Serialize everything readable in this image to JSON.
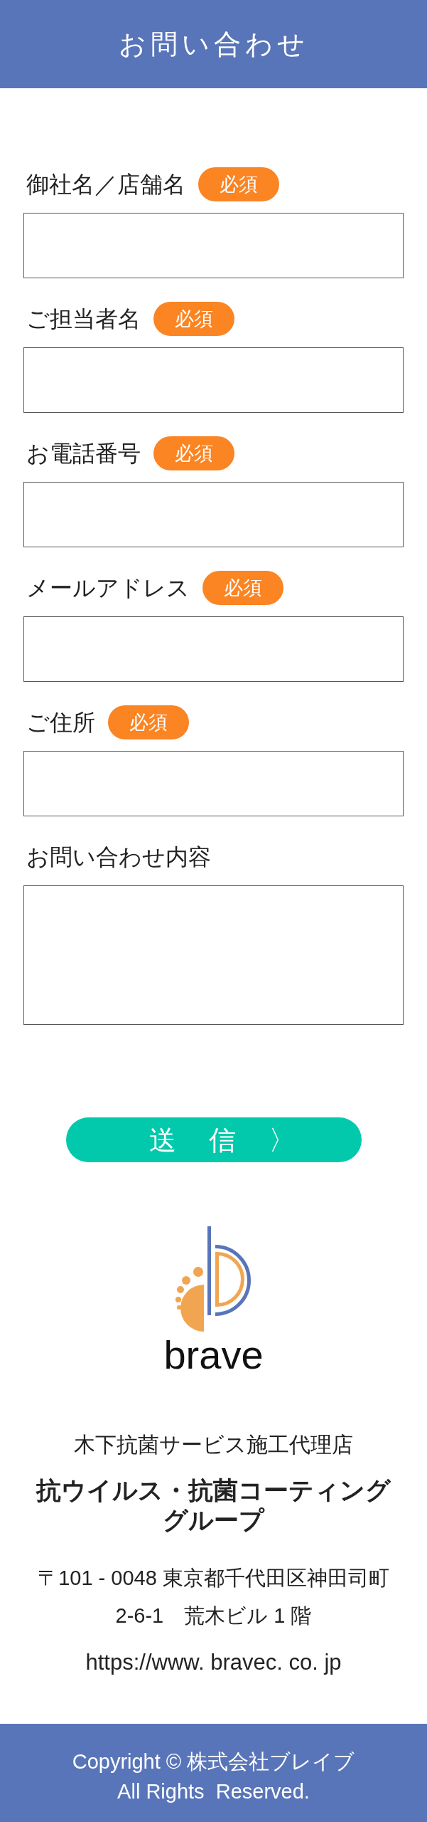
{
  "header": {
    "title": "お問い合わせ"
  },
  "form": {
    "fields": [
      {
        "label": "御社名／店舗名",
        "badge": "必須",
        "kind": "input"
      },
      {
        "label": "ご担当者名",
        "badge": "必須",
        "kind": "input"
      },
      {
        "label": "お電話番号",
        "badge": "必須",
        "kind": "input"
      },
      {
        "label": "メールアドレス",
        "badge": "必須",
        "kind": "input"
      },
      {
        "label": "ご住所",
        "badge": "必須",
        "kind": "input"
      },
      {
        "label": "お問い合わせ内容",
        "kind": "textarea"
      }
    ],
    "submit_button": {
      "label": "送　信　〉"
    }
  },
  "logo": {
    "wordmark": "brave"
  },
  "company": {
    "tagline": "木下抗菌サービス施工代理店",
    "group_name": "抗ウイルス・抗菌コーティンググループ",
    "address_lines": [
      "〒101 - 0048 東京都千代田区神田司町",
      "2-6-1　荒木ビル 1 階"
    ],
    "website": "https://www. bravec. co. jp"
  },
  "footer": {
    "copyright_lines": [
      "Copyright © 株式会社ブレイブ",
      "All Rights  Reserved."
    ]
  }
}
